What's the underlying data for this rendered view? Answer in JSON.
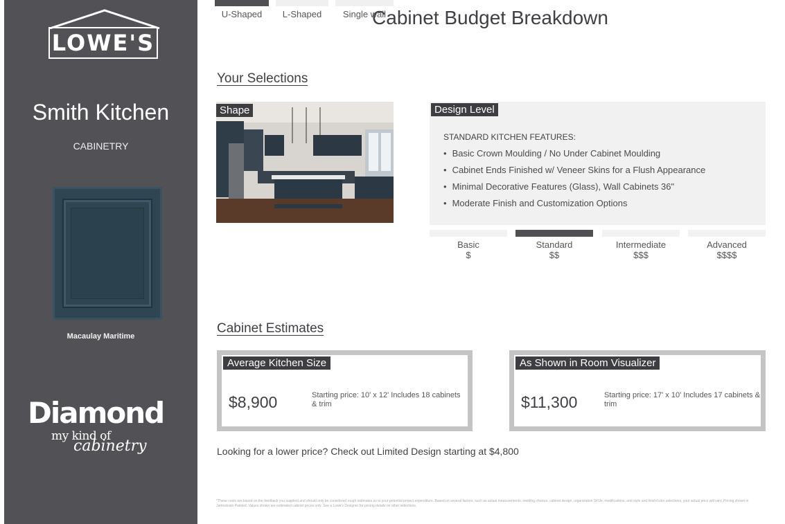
{
  "sidebar": {
    "logo_text": "LOWE'S",
    "kitchen_name": "Smith Kitchen",
    "category": "CABINETRY",
    "finish_name": "Macaulay Maritime",
    "brand": "Diamond",
    "brand_reg": "®",
    "brand_tagline_1": "my kind of",
    "brand_tagline_2": "cabinetry"
  },
  "main": {
    "title": "Cabinet Budget Breakdown",
    "selections_heading": "Your Selections",
    "shape": {
      "tag": "Shape",
      "options": [
        {
          "label": "U-Shaped",
          "active": true
        },
        {
          "label": "L-Shaped",
          "active": false
        },
        {
          "label": "Single wall",
          "active": false
        }
      ]
    },
    "design_level": {
      "tag": "Design Level",
      "features_heading": "STANDARD KITCHEN FEATURES:",
      "features": [
        "Basic Crown Moulding / No Under Cabinet Moulding",
        "Cabinet Ends Finished w/ Veneer Skins for a Flush Appearance",
        "Minimal Decorative Features (Glass), Wall Cabinets 36\"",
        "Moderate Finish and Customization Options"
      ],
      "levels": [
        {
          "label": "Basic",
          "price": "$",
          "active": false
        },
        {
          "label": "Standard",
          "price": "$$",
          "active": true
        },
        {
          "label": "Intermediate",
          "price": "$$$",
          "active": false
        },
        {
          "label": "Advanced",
          "price": "$$$$",
          "active": false
        }
      ]
    },
    "estimates_heading": "Cabinet Estimates",
    "estimates": [
      {
        "tag": "Average Kitchen Size",
        "amount": "$8,900",
        "description": "Starting price: 10' x 12' Includes 18 cabinets & trim"
      },
      {
        "tag": "As Shown in Room Visualizer",
        "amount": "$11,300",
        "description": "Starting price: 17' x 10' Includes 17 cabinets & trim"
      }
    ],
    "promo": "Looking for a lower price? Check out Limited Design starting at $4,800",
    "disclaimer": "*These costs are based on the feedback you supplied and should only be considered rough estimates as to your potential project expenditure. Based on several factors, such as actual measurements, molding choices, cabinet design, organization SKUs, modifications, and style and finish/color selections, your actual price will vary. Pricing shown in Jamestown Painted. Values shown are estimated cabinet prices only. See a Lowe's Designer for pricing details on other selections."
  },
  "colors": {
    "sidebar_bg": "#525256",
    "tag_bg": "#3d3d42",
    "active_bar": "#4f4f54",
    "card_border": "#c4c4c4",
    "door_color": "#2f4552"
  }
}
